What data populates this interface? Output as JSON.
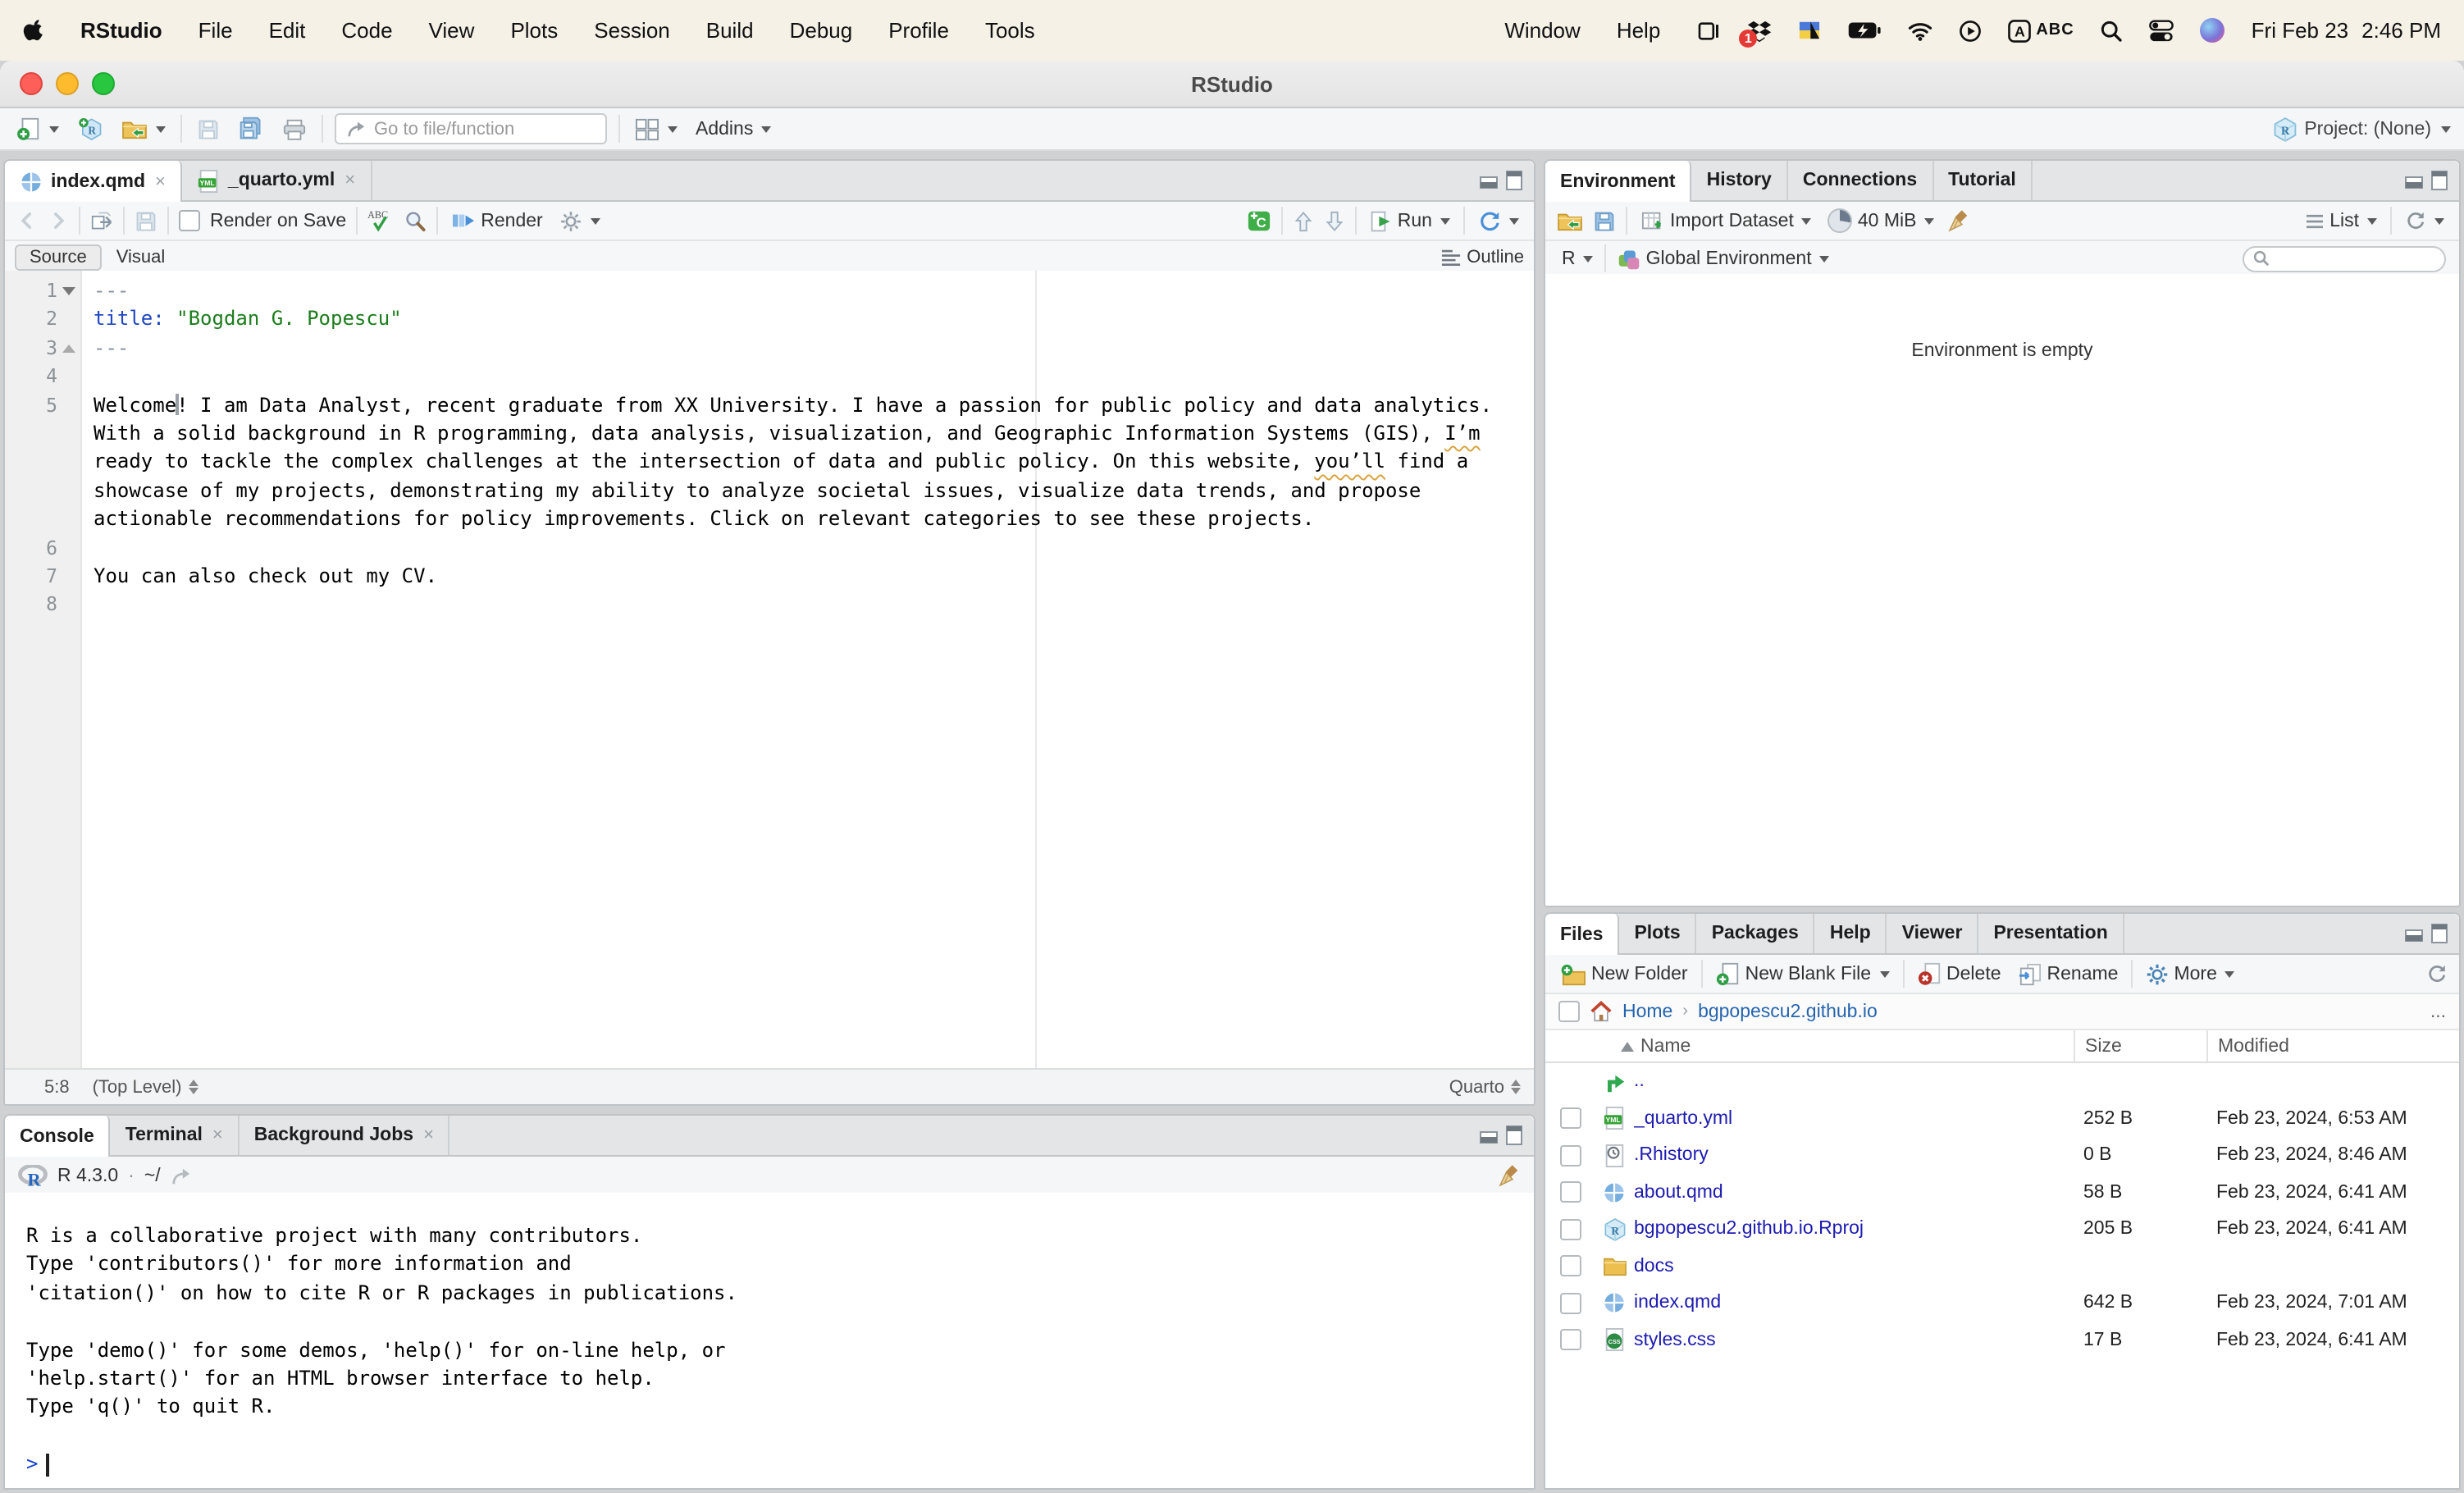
{
  "menu_bar": {
    "items": [
      "RStudio",
      "File",
      "Edit",
      "Code",
      "View",
      "Plots",
      "Session",
      "Build",
      "Debug",
      "Profile",
      "Tools"
    ],
    "right_items": [
      "Window",
      "Help"
    ],
    "status_icons": [
      "sidecar-icon",
      "dropbox-icon",
      "keyboard-flag-icon",
      "battery-icon",
      "wifi-icon",
      "play-circle-icon",
      "input-source-icon",
      "spotlight-icon",
      "control-center-icon",
      "siri-icon"
    ],
    "dropbox_badge": "1",
    "input_source_label": "ABC",
    "date": "Fri Feb 23",
    "time": "2:46 PM"
  },
  "window": {
    "title": "RStudio"
  },
  "main_toolbar": {
    "goto_placeholder": "Go to file/function",
    "addins_label": "Addins",
    "project_label": "Project: (None)"
  },
  "source_pane": {
    "tabs": [
      {
        "label": "index.qmd",
        "icon": "quarto-file-icon",
        "active": true,
        "closable": true
      },
      {
        "label": "_quarto.yml",
        "icon": "yml-file-icon",
        "active": false,
        "closable": true
      }
    ],
    "toolbar": {
      "render_on_save": "Render on Save",
      "render": "Render",
      "run": "Run"
    },
    "mode": {
      "source": "Source",
      "visual": "Visual",
      "outline": "Outline"
    },
    "editor": {
      "lines": [
        {
          "num": "1",
          "fold": "down",
          "rows": [
            [
              {
                "t": "---",
                "c": "meta"
              }
            ]
          ]
        },
        {
          "num": "2",
          "rows": [
            [
              {
                "t": "title: ",
                "c": "key"
              },
              {
                "t": "\"Bogdan G. Popescu\"",
                "c": "str"
              }
            ]
          ]
        },
        {
          "num": "3",
          "fold": "up",
          "rows": [
            [
              {
                "t": "---",
                "c": "meta"
              }
            ]
          ]
        },
        {
          "num": "4",
          "rows": [
            []
          ]
        },
        {
          "num": "5",
          "rows": [
            [
              {
                "t": "Welcome"
              },
              {
                "c": "cursor"
              },
              {
                "t": "! I am Data Analyst, recent graduate from XX University. I have a passion for public policy and data analytics."
              }
            ],
            [
              {
                "t": "With a solid background in R programming, data analysis, visualization, and Geographic Information Systems (GIS), "
              },
              {
                "t": "I’m",
                "c": "sp"
              }
            ],
            [
              {
                "t": "ready to tackle the complex challenges at the intersection of data and public policy. On this website, "
              },
              {
                "t": "you’ll",
                "c": "sp"
              },
              {
                "t": " find a"
              }
            ],
            [
              {
                "t": "showcase of my projects, demonstrating my ability to analyze societal issues, visualize data trends, and propose"
              }
            ],
            [
              {
                "t": "actionable recommendations for policy improvements. Click on relevant categories to see these projects."
              }
            ]
          ]
        },
        {
          "num": "6",
          "rows": [
            []
          ]
        },
        {
          "num": "7",
          "rows": [
            [
              {
                "t": "You can also check out my CV."
              }
            ]
          ]
        },
        {
          "num": "8",
          "rows": [
            []
          ]
        }
      ]
    },
    "status": {
      "cursor_position": "5:8",
      "scope": "(Top Level)",
      "doc_type": "Quarto"
    }
  },
  "console_pane": {
    "tabs": [
      {
        "label": "Console",
        "active": true
      },
      {
        "label": "Terminal",
        "closable": true
      },
      {
        "label": "Background Jobs",
        "closable": true
      }
    ],
    "header": {
      "engine": "R 4.3.0",
      "separator": "·",
      "dir": "~/"
    },
    "lines": [
      "R is a collaborative project with many contributors.",
      "Type 'contributors()' for more information and",
      "'citation()' on how to cite R or R packages in publications.",
      "",
      "Type 'demo()' for some demos, 'help()' for on-line help, or",
      "'help.start()' for an HTML browser interface to help.",
      "Type 'q()' to quit R.",
      ""
    ],
    "prompt": ">"
  },
  "environment_pane": {
    "tabs": [
      {
        "label": "Environment",
        "active": true
      },
      {
        "label": "History"
      },
      {
        "label": "Connections"
      },
      {
        "label": "Tutorial"
      }
    ],
    "toolbar": {
      "import_label": "Import Dataset",
      "memory_label": "40 MiB",
      "view_label": "List"
    },
    "row2": {
      "language": "R",
      "scope_label": "Global Environment"
    },
    "empty_message": "Environment is empty"
  },
  "files_pane": {
    "tabs": [
      {
        "label": "Files",
        "active": true
      },
      {
        "label": "Plots"
      },
      {
        "label": "Packages"
      },
      {
        "label": "Help"
      },
      {
        "label": "Viewer"
      },
      {
        "label": "Presentation"
      }
    ],
    "toolbar": {
      "new_folder": "New Folder",
      "new_blank_file": "New Blank File",
      "delete": "Delete",
      "rename": "Rename",
      "more": "More"
    },
    "breadcrumb": {
      "items": [
        "Home",
        "bgpopescu2.github.io"
      ],
      "overflow": "..."
    },
    "table": {
      "columns": [
        "Name",
        "Size",
        "Modified"
      ],
      "rows": [
        {
          "icon": "up-dir-icon",
          "name": "..",
          "size": "",
          "modified": "",
          "checkbox": false
        },
        {
          "icon": "yml-file-icon",
          "name": "_quarto.yml",
          "size": "252 B",
          "modified": "Feb 23, 2024, 6:53 AM",
          "checkbox": true
        },
        {
          "icon": "rhistory-file-icon",
          "name": ".Rhistory",
          "size": "0 B",
          "modified": "Feb 23, 2024, 8:46 AM",
          "checkbox": true
        },
        {
          "icon": "quarto-file-icon",
          "name": "about.qmd",
          "size": "58 B",
          "modified": "Feb 23, 2024, 6:41 AM",
          "checkbox": true
        },
        {
          "icon": "rproj-file-icon",
          "name": "bgpopescu2.github.io.Rproj",
          "size": "205 B",
          "modified": "Feb 23, 2024, 6:41 AM",
          "checkbox": true
        },
        {
          "icon": "folder-icon",
          "name": "docs",
          "size": "",
          "modified": "",
          "checkbox": true
        },
        {
          "icon": "quarto-file-icon",
          "name": "index.qmd",
          "size": "642 B",
          "modified": "Feb 23, 2024, 7:01 AM",
          "checkbox": true
        },
        {
          "icon": "css-file-icon",
          "name": "styles.css",
          "size": "17 B",
          "modified": "Feb 23, 2024, 6:41 AM",
          "checkbox": true
        }
      ]
    }
  },
  "colors": {
    "menu_bar_bg": "#f5f1e7",
    "accent_blue": "#4a90d9",
    "yaml_key": "#2048c0",
    "yaml_string": "#1d7d1d",
    "yaml_meta": "#8590a0",
    "file_link": "#1d1bb0",
    "breadcrumb_link": "#2565ae",
    "prompt_blue": "#1a44cc",
    "misspell_underline": "#d9a23c",
    "green_plus": "#2f9e44"
  }
}
